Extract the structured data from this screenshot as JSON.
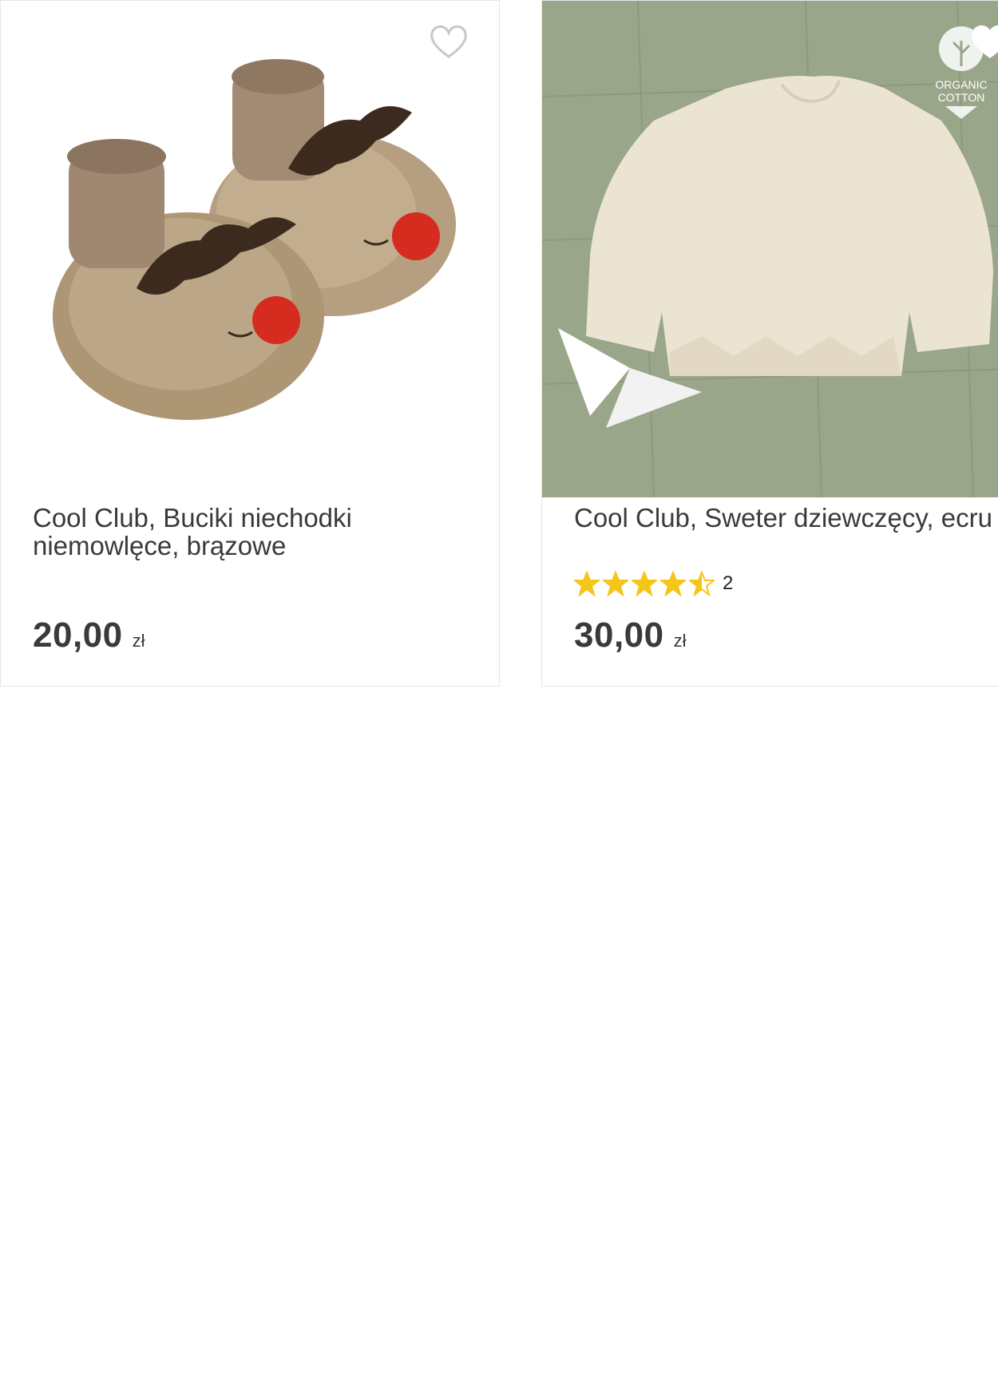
{
  "products": [
    {
      "title": "Cool Club, Buciki niechodki niemowlęce, brązowe",
      "price": "20,00",
      "currency": "zł",
      "rating": null,
      "rating_count": null,
      "favorite_icon": "heart-outline-icon"
    },
    {
      "title": "Cool Club, Sweter dziewczęcy, ecru",
      "price": "30,00",
      "currency": "zł",
      "rating": 4.5,
      "rating_count": "2",
      "favorite_icon": "heart-outline-icon",
      "badge_line1": "ORGANIC",
      "badge_line2": "COTTON"
    }
  ],
  "colors": {
    "star": "#f5c518",
    "text": "#3a3a3a",
    "border": "#e6e6e6",
    "card2_bg": "#9aa68a"
  }
}
